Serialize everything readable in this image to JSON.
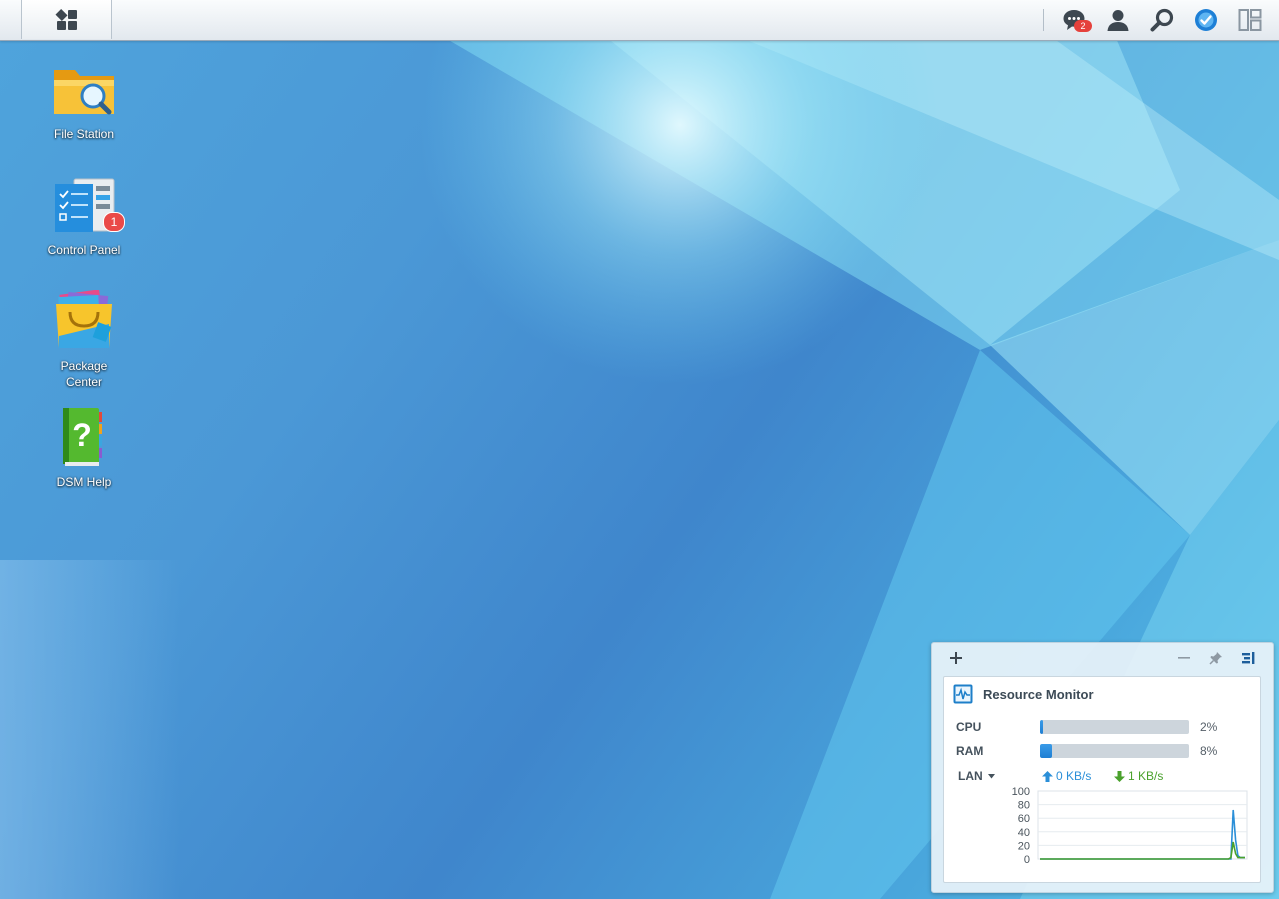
{
  "taskbar": {
    "icons": [
      "main-menu-icon",
      "chat-icon",
      "user-icon",
      "search-icon",
      "dsm-assistant-icon",
      "widgets-icon"
    ],
    "notification_count": "2"
  },
  "desktop": {
    "icons": [
      {
        "label": "File Station",
        "icon": "folder-search-icon"
      },
      {
        "label": "Control Panel",
        "icon": "control-panel-icon",
        "badge": "1"
      },
      {
        "label": "Package\nCenter",
        "icon": "shopping-bag-icon"
      },
      {
        "label": "DSM Help",
        "icon": "help-book-icon"
      }
    ]
  },
  "widget": {
    "title": "Resource Monitor",
    "cpu": {
      "label": "CPU",
      "value": "2%",
      "fraction": 0.02
    },
    "ram": {
      "label": "RAM",
      "value": "8%",
      "fraction": 0.08
    },
    "network": {
      "label": "LAN",
      "upload": "0 KB/s",
      "download": "1 KB/s"
    },
    "colors": {
      "upload": "#2b8fd8",
      "download": "#4aa12c",
      "bar": "#2a8ddf"
    }
  },
  "chart_data": {
    "type": "line",
    "title": "",
    "xlabel": "",
    "ylabel": "",
    "ylim": [
      0,
      100
    ],
    "y_ticks": [
      "100",
      "80",
      "60",
      "40",
      "20",
      "0"
    ],
    "series": [
      {
        "color": "#2b8fd8",
        "values": [
          0,
          0,
          0,
          0,
          0,
          0,
          0,
          0,
          0,
          0,
          0,
          0,
          0,
          0,
          0,
          0,
          0,
          0,
          0,
          0,
          0,
          0,
          0,
          0,
          0,
          0,
          0,
          0,
          0,
          0,
          0,
          0,
          0,
          0,
          0,
          0,
          0,
          0,
          0,
          0,
          0,
          0,
          0,
          0,
          0,
          0,
          0,
          0,
          0,
          0,
          0,
          0,
          0,
          0,
          0,
          0,
          0,
          0,
          0,
          0,
          0,
          0,
          0,
          0,
          0,
          0,
          0,
          0,
          0,
          0,
          0,
          0,
          0,
          0,
          0,
          0,
          0,
          0,
          0,
          0,
          0,
          0,
          72,
          28,
          5,
          2,
          2,
          2
        ]
      },
      {
        "color": "#4aa12c",
        "values": [
          0,
          0,
          0,
          0,
          0,
          0,
          0,
          0,
          0,
          0,
          0,
          0,
          0,
          0,
          0,
          0,
          0,
          0,
          0,
          0,
          0,
          0,
          0,
          0,
          0,
          0,
          0,
          0,
          0,
          0,
          0,
          0,
          0,
          0,
          0,
          0,
          0,
          0,
          0,
          0,
          0,
          0,
          0,
          0,
          0,
          0,
          0,
          0,
          0,
          0,
          0,
          0,
          0,
          0,
          0,
          0,
          0,
          0,
          0,
          0,
          0,
          0,
          0,
          0,
          0,
          0,
          0,
          0,
          0,
          0,
          0,
          0,
          0,
          0,
          0,
          0,
          0,
          0,
          0,
          0,
          0,
          2,
          25,
          8,
          2,
          2,
          2,
          2
        ]
      }
    ],
    "grid": true,
    "legend": "none"
  }
}
